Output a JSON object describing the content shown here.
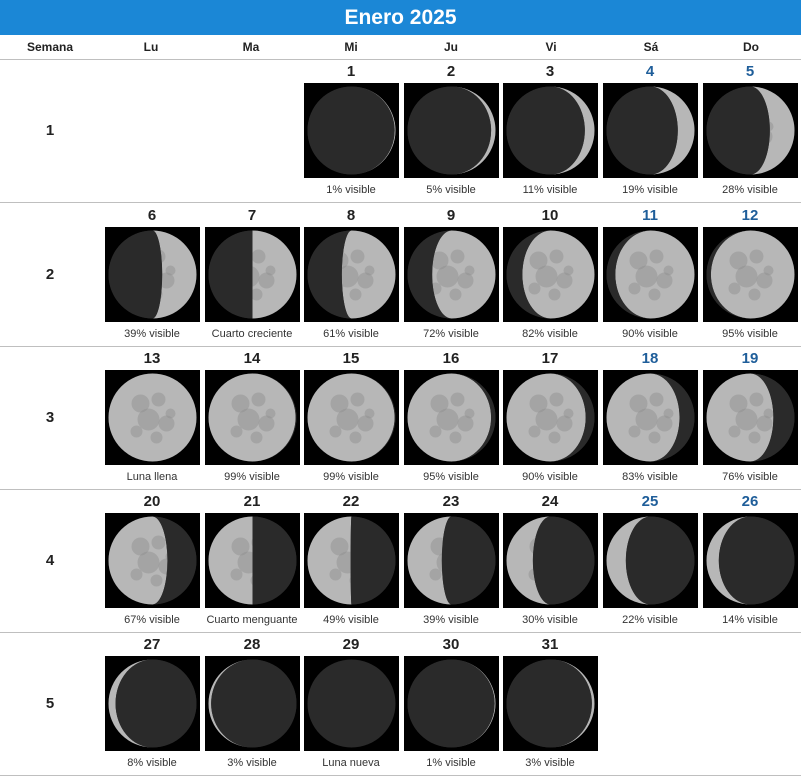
{
  "title": "Enero 2025",
  "header": [
    "Semana",
    "Lu",
    "Ma",
    "Mi",
    "Ju",
    "Vi",
    "Sá",
    "Do"
  ],
  "weeks": [
    {
      "label": "1",
      "days": [
        {
          "col": 3,
          "num": "1",
          "label": "1% visible",
          "illum": 0.01,
          "waxing": true
        },
        {
          "col": 4,
          "num": "2",
          "label": "5% visible",
          "illum": 0.05,
          "waxing": true
        },
        {
          "col": 5,
          "num": "3",
          "label": "11% visible",
          "illum": 0.11,
          "waxing": true
        },
        {
          "col": 6,
          "num": "4",
          "label": "19% visible",
          "illum": 0.19,
          "waxing": true
        },
        {
          "col": 7,
          "num": "5",
          "label": "28% visible",
          "illum": 0.28,
          "waxing": true
        }
      ]
    },
    {
      "label": "2",
      "days": [
        {
          "col": 1,
          "num": "6",
          "label": "39% visible",
          "illum": 0.39,
          "waxing": true
        },
        {
          "col": 2,
          "num": "7",
          "label": "Cuarto creciente",
          "illum": 0.5,
          "waxing": true
        },
        {
          "col": 3,
          "num": "8",
          "label": "61% visible",
          "illum": 0.61,
          "waxing": true
        },
        {
          "col": 4,
          "num": "9",
          "label": "72% visible",
          "illum": 0.72,
          "waxing": true
        },
        {
          "col": 5,
          "num": "10",
          "label": "82% visible",
          "illum": 0.82,
          "waxing": true
        },
        {
          "col": 6,
          "num": "11",
          "label": "90% visible",
          "illum": 0.9,
          "waxing": true
        },
        {
          "col": 7,
          "num": "12",
          "label": "95% visible",
          "illum": 0.95,
          "waxing": true
        }
      ]
    },
    {
      "label": "3",
      "days": [
        {
          "col": 1,
          "num": "13",
          "label": "Luna llena",
          "illum": 1.0,
          "waxing": true
        },
        {
          "col": 2,
          "num": "14",
          "label": "99% visible",
          "illum": 0.99,
          "waxing": false
        },
        {
          "col": 3,
          "num": "15",
          "label": "99% visible",
          "illum": 0.99,
          "waxing": false
        },
        {
          "col": 4,
          "num": "16",
          "label": "95% visible",
          "illum": 0.95,
          "waxing": false
        },
        {
          "col": 5,
          "num": "17",
          "label": "90% visible",
          "illum": 0.9,
          "waxing": false
        },
        {
          "col": 6,
          "num": "18",
          "label": "83% visible",
          "illum": 0.83,
          "waxing": false
        },
        {
          "col": 7,
          "num": "19",
          "label": "76% visible",
          "illum": 0.76,
          "waxing": false
        }
      ]
    },
    {
      "label": "4",
      "days": [
        {
          "col": 1,
          "num": "20",
          "label": "67% visible",
          "illum": 0.67,
          "waxing": false
        },
        {
          "col": 2,
          "num": "21",
          "label": "Cuarto menguante",
          "illum": 0.5,
          "waxing": false
        },
        {
          "col": 3,
          "num": "22",
          "label": "49% visible",
          "illum": 0.49,
          "waxing": false
        },
        {
          "col": 4,
          "num": "23",
          "label": "39% visible",
          "illum": 0.39,
          "waxing": false
        },
        {
          "col": 5,
          "num": "24",
          "label": "30% visible",
          "illum": 0.3,
          "waxing": false
        },
        {
          "col": 6,
          "num": "25",
          "label": "22% visible",
          "illum": 0.22,
          "waxing": false
        },
        {
          "col": 7,
          "num": "26",
          "label": "14% visible",
          "illum": 0.14,
          "waxing": false
        }
      ]
    },
    {
      "label": "5",
      "days": [
        {
          "col": 1,
          "num": "27",
          "label": "8% visible",
          "illum": 0.08,
          "waxing": false
        },
        {
          "col": 2,
          "num": "28",
          "label": "3% visible",
          "illum": 0.03,
          "waxing": false
        },
        {
          "col": 3,
          "num": "29",
          "label": "Luna nueva",
          "illum": 0.0,
          "waxing": true
        },
        {
          "col": 4,
          "num": "30",
          "label": "1% visible",
          "illum": 0.01,
          "waxing": true
        },
        {
          "col": 5,
          "num": "31",
          "label": "3% visible",
          "illum": 0.03,
          "waxing": true
        }
      ]
    }
  ],
  "colors": {
    "header_bg": "#1b87d6",
    "weekend_num": "#1f5e9a",
    "lit": "#b7b7b7",
    "dark": "#2a2a2a"
  }
}
